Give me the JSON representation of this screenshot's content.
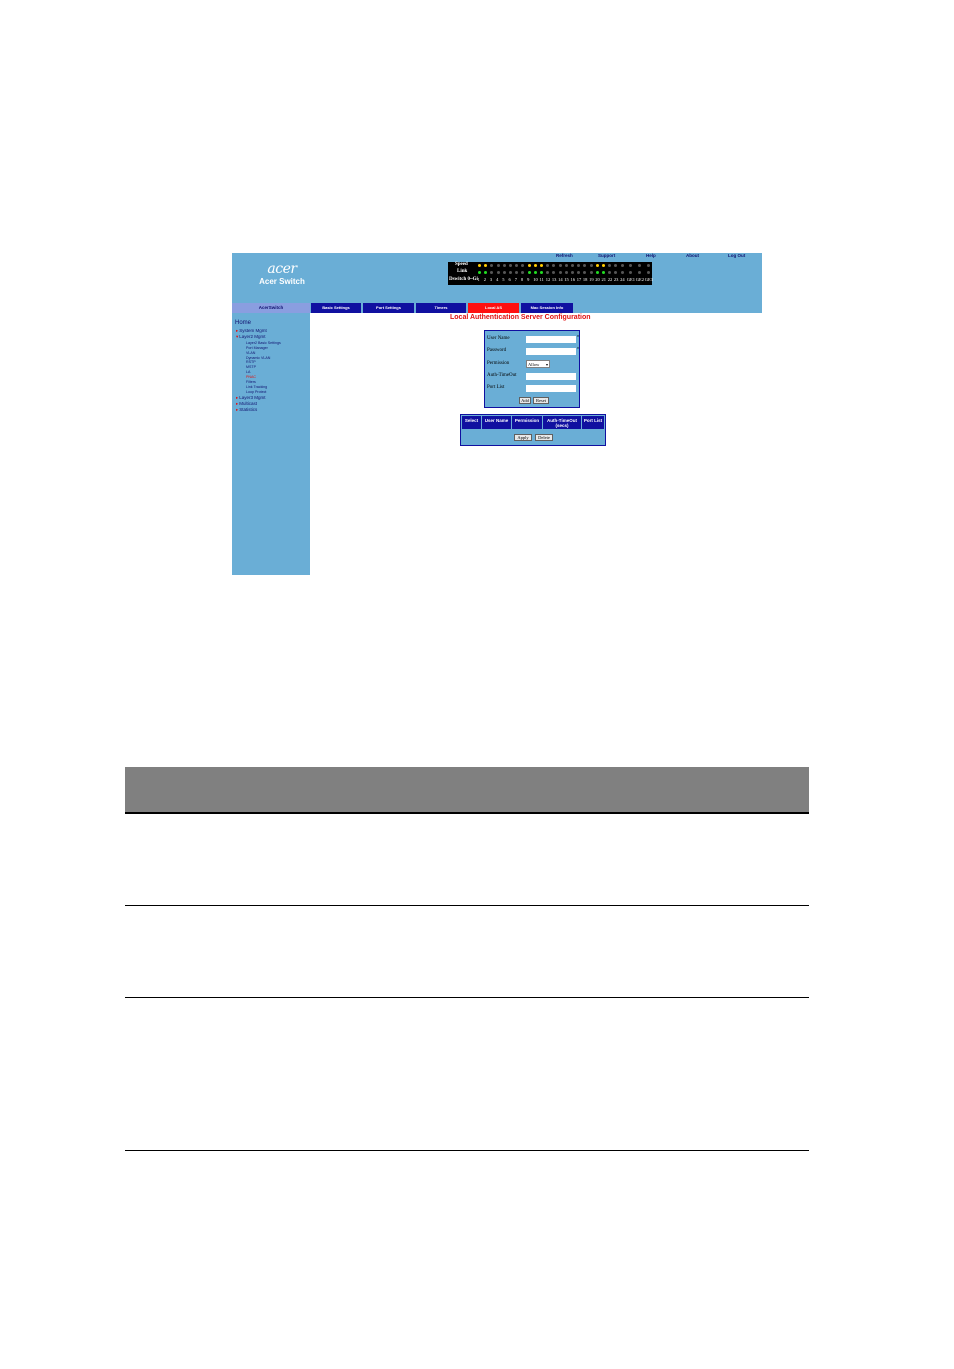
{
  "banner": {
    "logo_text": "acer",
    "product_name": "Acer Switch",
    "links": [
      "Refresh",
      "Support",
      "Help",
      "About",
      "Log Out"
    ]
  },
  "port_panel": {
    "row_labels": [
      "Speed",
      "Link",
      "Dswitch 0~Gi"
    ],
    "port_numbers": [
      "1",
      "2",
      "3",
      "4",
      "5",
      "6",
      "7",
      "8",
      "9",
      "10",
      "11",
      "12",
      "13",
      "14",
      "15",
      "16",
      "17",
      "18",
      "19",
      "20",
      "21",
      "22",
      "23",
      "24"
    ],
    "uplink_labels": [
      "GE1",
      "GE2",
      "GE3"
    ],
    "colors": {
      "speed_on": "#ffcc00",
      "link_on": "#22dd22",
      "off": "#555555"
    }
  },
  "tabs": {
    "sidebar_header": "AcerSwitch",
    "items": [
      "Basic Settings",
      "Port Settings",
      "Timers",
      "Local AS",
      "Mac Session Info"
    ],
    "active": "Local AS"
  },
  "sidebar": {
    "home": "Home",
    "sections": [
      {
        "label": "System Mgmt"
      },
      {
        "label": "Layer2 Mgmt",
        "children": [
          "Layer2 Basic Settings",
          "Port Manager",
          "VLAN",
          "Dynamic VLAN",
          "RSTP",
          "MSTP",
          "LA",
          "PNAC",
          "Filters",
          "Link Tracking",
          "Loop Protect"
        ],
        "current": "PNAC"
      },
      {
        "label": "Layer3 Mgmt"
      },
      {
        "label": "Multicast"
      },
      {
        "label": "Statistics"
      }
    ]
  },
  "content": {
    "title": "Local Authentication Server Configuration",
    "form": {
      "user_name_label": "User Name",
      "password_label": "Password",
      "permission_label": "Permission",
      "permission_value": "Allow",
      "auth_timeout_label": "Auth-TimeOut",
      "port_list_label": "Port List",
      "required_mark": "*",
      "add_button": "Add",
      "reset_button": "Reset"
    },
    "users_table": {
      "columns": [
        "Select",
        "User Name",
        "Permission",
        "Auth-TimeOut (secs)",
        "Port List"
      ],
      "apply_button": "Apply",
      "delete_button": "Delete"
    }
  },
  "colors": {
    "banner": "#6aaed6",
    "tab": "#1010a0",
    "tab_active": "#ff1010",
    "title": "#e01010"
  }
}
